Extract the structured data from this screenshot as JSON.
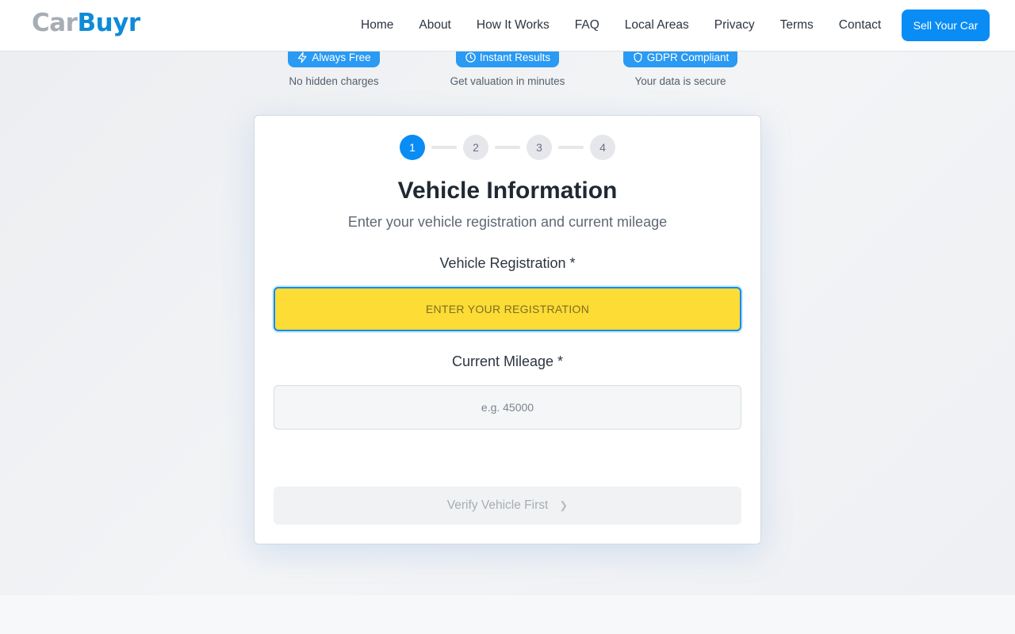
{
  "header": {
    "logo_part1": "Car",
    "logo_part2": "Buyr",
    "nav": [
      "Home",
      "About",
      "How It Works",
      "FAQ",
      "Local Areas",
      "Privacy",
      "Terms",
      "Contact"
    ],
    "cta_label": "Sell Your Car"
  },
  "badges": [
    {
      "label": "Always Free",
      "sub": "No hidden charges",
      "icon": "lightning-icon"
    },
    {
      "label": "Instant Results",
      "sub": "Get valuation in minutes",
      "icon": "clock-icon"
    },
    {
      "label": "GDPR Compliant",
      "sub": "Your data is secure",
      "icon": "shield-icon"
    }
  ],
  "form": {
    "steps": [
      "1",
      "2",
      "3",
      "4"
    ],
    "active_step": 1,
    "title": "Vehicle Information",
    "subtitle": "Enter your vehicle registration and current mileage",
    "registration_label": "Vehicle Registration *",
    "registration_placeholder": "ENTER YOUR REGISTRATION",
    "registration_value": "",
    "mileage_label": "Current Mileage *",
    "mileage_placeholder": "e.g. 45000",
    "mileage_value": "",
    "submit_label": "Verify Vehicle First"
  },
  "colors": {
    "primary": "#0a8cf5",
    "badge": "#2a9af3",
    "plate_yellow": "#fcdc35",
    "logo_grey": "#a7adb4",
    "logo_blue": "#0d8bd9"
  }
}
